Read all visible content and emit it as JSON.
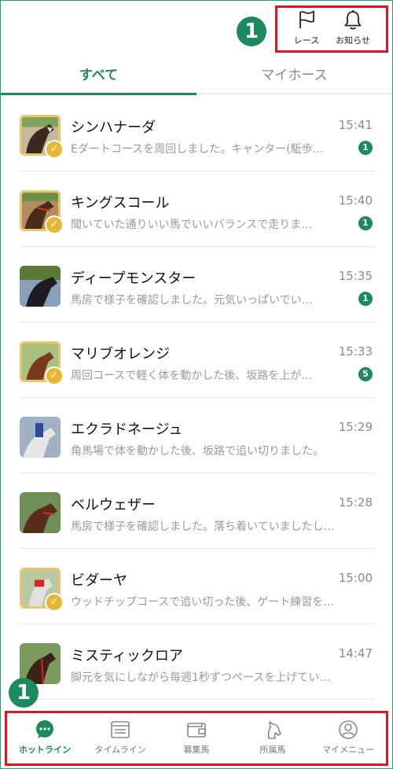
{
  "header": {
    "callout_number": "1",
    "race_label": "レース",
    "notice_label": "お知らせ"
  },
  "tabs": [
    {
      "label": "すべて",
      "active": true
    },
    {
      "label": "マイホース",
      "active": false
    }
  ],
  "colors": {
    "accent": "#1d8a5d",
    "highlight": "#e3141b",
    "gold": "#e8b731"
  },
  "timeline": [
    {
      "name": "シンハナーダ",
      "time": "15:41",
      "message": "Eダートコースを周回しました。キャンター(駈歩…",
      "unread": "1",
      "gold": true
    },
    {
      "name": "キングスコール",
      "time": "15:40",
      "message": "聞いていた通りいい馬でいいバランスで走りま…",
      "unread": "1",
      "gold": true
    },
    {
      "name": "ディープモンスター",
      "time": "15:35",
      "message": "馬房で様子を確認しました。元気いっぱいでい…",
      "unread": "1",
      "gold": false
    },
    {
      "name": "マリブオレンジ",
      "time": "15:33",
      "message": "周回コースで軽く体を動かした後、坂路を上が…",
      "unread": "5",
      "gold": true
    },
    {
      "name": "エクラドネージュ",
      "time": "15:29",
      "message": "角馬場で体を動かした後、坂路で追い切りました。",
      "unread": "",
      "gold": false
    },
    {
      "name": "ベルウェザー",
      "time": "15:28",
      "message": "馬房で様子を確認しました。落ち着いていましたし…",
      "unread": "",
      "gold": false
    },
    {
      "name": "ビダーヤ",
      "time": "15:00",
      "message": "ウッドチップコースで追い切った後、ゲート練習を…",
      "unread": "",
      "gold": true
    },
    {
      "name": "ミスティックロア",
      "time": "14:47",
      "message": "脚元を気にしながら毎週1秒ずつペースを上げてい…",
      "unread": "",
      "gold": false
    }
  ],
  "bottom_nav": {
    "callout_number": "1",
    "items": [
      {
        "label": "ホットライン",
        "icon": "chat-bubble-icon",
        "active": true
      },
      {
        "label": "タイムライン",
        "icon": "timeline-icon",
        "active": false
      },
      {
        "label": "募集馬",
        "icon": "wallet-icon",
        "active": false
      },
      {
        "label": "所属馬",
        "icon": "horse-head-icon",
        "active": false
      },
      {
        "label": "マイメニュー",
        "icon": "user-circle-icon",
        "active": false
      }
    ]
  }
}
